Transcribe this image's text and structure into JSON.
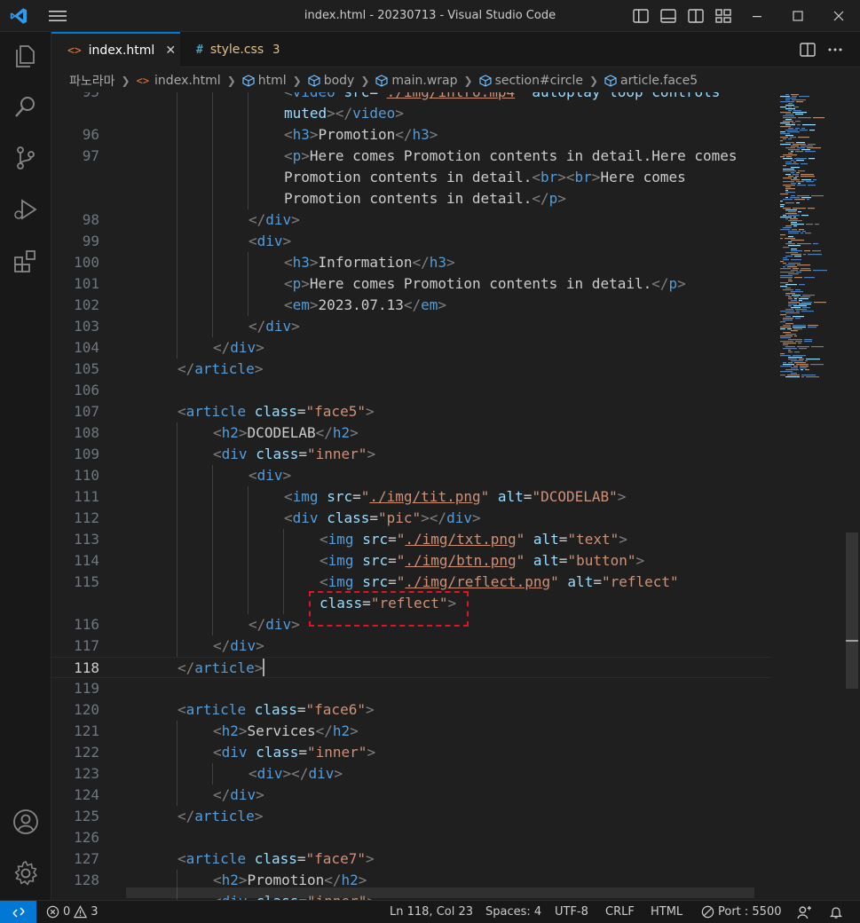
{
  "window": {
    "title": "index.html - 20230713 - Visual Studio Code"
  },
  "tabs": [
    {
      "label": "index.html",
      "icon": "html-file-icon",
      "active": true,
      "close": "✕"
    },
    {
      "label": "style.css",
      "icon": "css-file-icon",
      "active": false,
      "badge": "3"
    }
  ],
  "breadcrumb": [
    "파노라마",
    "index.html",
    "html",
    "body",
    "main.wrap",
    "section#circle",
    "article.face5"
  ],
  "editor": {
    "cursor_line": 118
  },
  "statusbar": {
    "errors": "0",
    "warnings": "3",
    "position": "Ln 118, Col 23",
    "spaces": "Spaces: 4",
    "encoding": "UTF-8",
    "eol": "CRLF",
    "language": "HTML",
    "port": "Port : 5500"
  },
  "colors": {
    "accent": "#0078d4",
    "highlight_box": "#e81123",
    "tag": "#569cd6",
    "attribute": "#9cdcfe",
    "string": "#ce9178"
  }
}
